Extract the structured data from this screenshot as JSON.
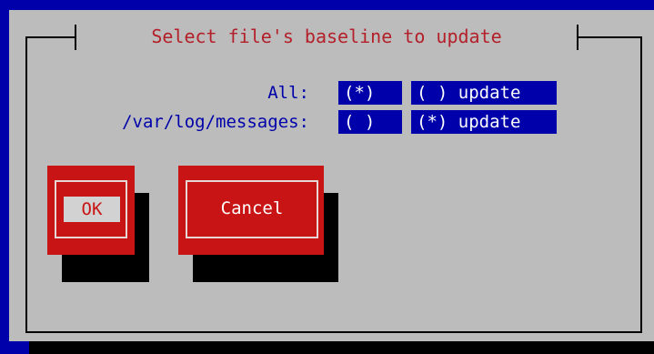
{
  "dialog": {
    "title": "Select file's baseline to update"
  },
  "rows": [
    {
      "label": "All:",
      "option1": "(*)",
      "option2": "( ) update"
    },
    {
      "label": "/var/log/messages:",
      "option1": "( )",
      "option2": "(*) update"
    }
  ],
  "buttons": {
    "ok": "OK",
    "cancel": "Cancel"
  },
  "colors": {
    "screen_bg": "#0000aa",
    "dialog_bg": "#bcbcbc",
    "title_text": "#b4202a",
    "button_bg": "#c81414",
    "label_text": "#0000aa",
    "radio_bg": "#0000aa",
    "radio_text": "#ffffff"
  }
}
